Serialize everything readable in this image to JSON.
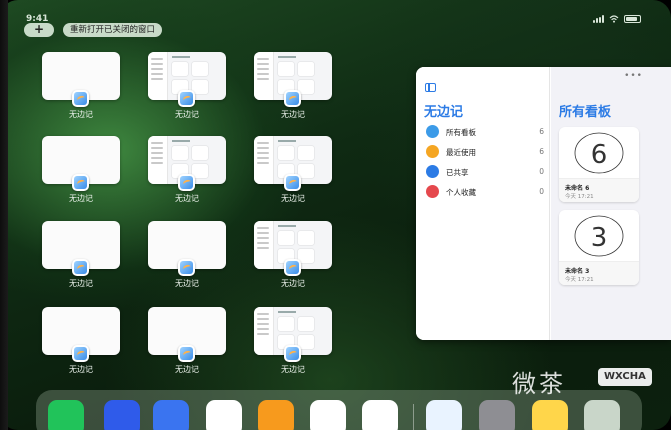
{
  "status_bar": {
    "time": "9:41"
  },
  "top_bar": {
    "add_label": "+",
    "reopen_label": "重新打开已关闭的窗口"
  },
  "windows": [
    {
      "label": "无边记"
    },
    {
      "label": "无边记"
    },
    {
      "label": "无边记"
    },
    {
      "label": "无边记"
    },
    {
      "label": "无边记"
    },
    {
      "label": "无边记"
    },
    {
      "label": "无边记"
    },
    {
      "label": "无边记"
    },
    {
      "label": "无边记"
    },
    {
      "label": "无边记"
    },
    {
      "label": "无边记"
    },
    {
      "label": "无边记"
    }
  ],
  "panel": {
    "sidebar_title": "无边记",
    "items": [
      {
        "label": "所有看板",
        "count": "6",
        "color": "#3c9be8",
        "icon": "boards-icon"
      },
      {
        "label": "最近使用",
        "count": "6",
        "color": "#f5a623",
        "icon": "clock-icon"
      },
      {
        "label": "已共享",
        "count": "0",
        "color": "#2c7be5",
        "icon": "people-icon"
      },
      {
        "label": "个人收藏",
        "count": "0",
        "color": "#e5484d",
        "icon": "heart-icon"
      }
    ],
    "content_title": "所有看板",
    "more_label": "•••",
    "boards": [
      {
        "name": "未命名 6",
        "time": "今天 17:21",
        "digit": "6"
      },
      {
        "name": "未命名 3",
        "time": "今天 17:21",
        "digit": "3"
      }
    ]
  },
  "dock": {
    "apps": [
      {
        "name": "wechat-icon",
        "color": "#21c35a"
      },
      {
        "name": "quark-icon",
        "color": "#2f5bea"
      },
      {
        "name": "baidu-netdisk-icon",
        "color": "#3a74f0"
      },
      {
        "name": "play-icon",
        "color": "#ffffff"
      },
      {
        "name": "books-icon",
        "color": "#f79a1d"
      },
      {
        "name": "dice-icon",
        "color": "#ffffff"
      },
      {
        "name": "molecule-icon",
        "color": "#ffffff"
      },
      {
        "name": "freeform-icon",
        "color": "#e9f3ff"
      },
      {
        "name": "settings-icon",
        "color": "#8e8e93"
      },
      {
        "name": "notes-icon",
        "color": "#ffd64a"
      },
      {
        "name": "folder-icon",
        "color": "#c9d6c9"
      }
    ]
  },
  "watermark": {
    "text": "微茶",
    "badge": "WXCHA"
  }
}
